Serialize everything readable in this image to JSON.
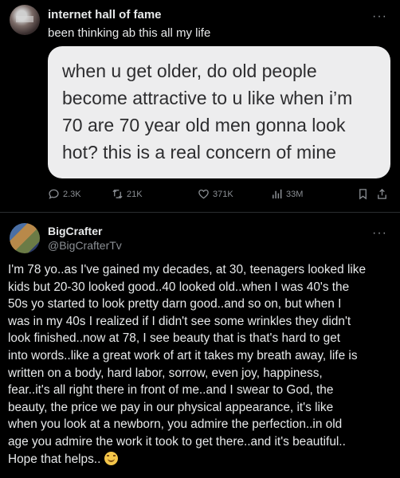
{
  "post1": {
    "author": "internet hall of fame",
    "text": "been thinking ab this all my life",
    "more_label": "···",
    "quote_lines": [
      "when u get older, do old people",
      "become attractive to u like when i’m",
      "70 are 70 year old men gonna look",
      "hot? this is a real concern of mine"
    ],
    "actions": {
      "replies": "2.3K",
      "reposts": "21K",
      "likes": "371K",
      "views": "33M"
    }
  },
  "post2": {
    "author": "BigCrafter",
    "handle": "@BigCrafterTv",
    "more_label": "···",
    "body_lines": [
      "I'm 78 yo..as I've gained my decades, at 30, teenagers looked like",
      "kids but 20-30 looked good..40 looked old..when I was 40's the",
      "50s yo started to look pretty darn good..and so on, but when I",
      "was in my 40s I realized if I didn't see some wrinkles they didn't",
      "look finished..now at 78, I see beauty that is that's hard to get",
      "into words..like a great work of art it takes my breath away, life is",
      "written on a body, hard labor, sorrow, even joy, happiness,",
      "fear..it's all right there in front of me..and I swear to God,  the",
      "beauty, the price we pay in our physical appearance, it's like",
      "when you look at a newborn, you admire the perfection..in old",
      "age you admire the work it took to get there..and it's beautiful..",
      "Hope that helps.."
    ],
    "emoji": "relieved-face"
  },
  "colors": {
    "background": "#000000",
    "text": "#e7e9ea",
    "muted": "#8b8f94",
    "quote_card": "#ededee"
  }
}
